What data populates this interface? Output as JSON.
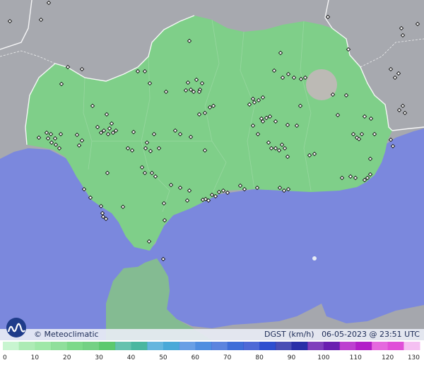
{
  "brand": {
    "copyright": "© Meteoclimatic",
    "logo_icon": "meteoclimatic-logo-icon"
  },
  "readout": {
    "variable": "DGST",
    "units": "(km/h)",
    "timestamp": "06-05-2023 @ 23:51 UTC"
  },
  "colors": {
    "sea": "#7b88dd",
    "land_outside": "#a9abb1",
    "land_region": "#7fd08a",
    "borders": "#ffffff",
    "station_marker": "#111111"
  },
  "legend": {
    "ticks": [
      "0",
      "10",
      "20",
      "30",
      "40",
      "50",
      "60",
      "70",
      "80",
      "90",
      "100",
      "110",
      "120",
      "130"
    ],
    "colors": [
      "#c8f5d0",
      "#9fe8a8",
      "#7dd98a",
      "#5cc96e",
      "#4ab7a0",
      "#4aa9d8",
      "#4f8ee0",
      "#3f6ed8",
      "#2f4fcf",
      "#2a2fa8",
      "#6a1fb0",
      "#b21fc8",
      "#e04fd8",
      "#f3b5f0"
    ]
  }
}
